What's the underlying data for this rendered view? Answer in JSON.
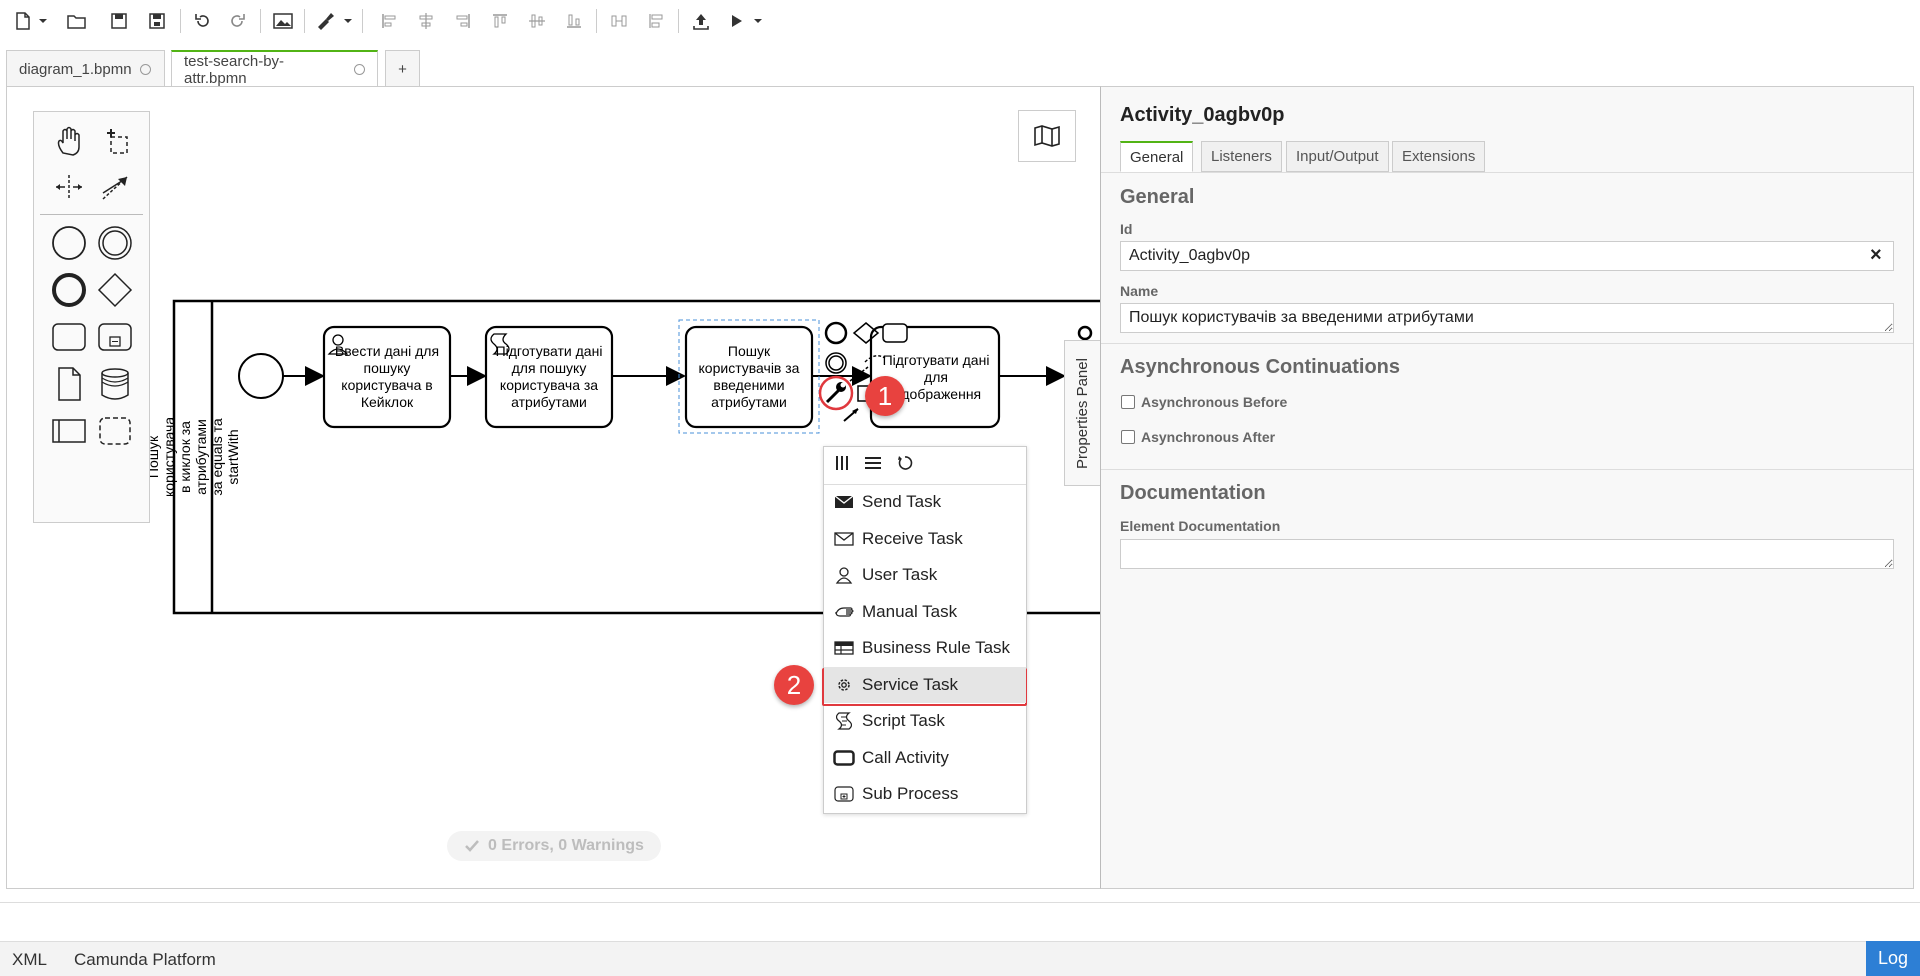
{
  "toolbar": {
    "buttons": [
      "new-file-icon",
      "open-folder-icon",
      "save-icon",
      "save-as-icon",
      "undo-icon",
      "redo-icon",
      "export-image-icon",
      "color-brush-icon",
      "align-left-icon",
      "align-center-icon",
      "align-right-icon",
      "align-top-icon",
      "align-middle-icon",
      "align-bottom-icon",
      "distribute-horizontal-icon",
      "distribute-vertical-icon",
      "deploy-icon",
      "run-icon"
    ]
  },
  "tabs": [
    {
      "label": "diagram_1.bpmn",
      "active": false
    },
    {
      "label": "test-search-by-attr.bpmn",
      "active": true
    }
  ],
  "add_tab_label": "+",
  "diagram": {
    "pool_label": "Пошук користувача в киклок за атрибутами за equals та startWith",
    "tasks": [
      {
        "label": "Ввести дані для пошуку користувача в Кейклок",
        "type": "user"
      },
      {
        "label": "Підготувати дані для пошуку користувача за атрибутами",
        "type": "script"
      },
      {
        "label": "Пошук користувачів за введеними атрибутами",
        "type": "task",
        "selected": true
      },
      {
        "label": "Підготувати дані для відображення",
        "type": "user"
      }
    ]
  },
  "popup_menu": {
    "items": [
      {
        "label": "Send Task",
        "icon": "envelope-filled-icon"
      },
      {
        "label": "Receive Task",
        "icon": "envelope-outline-icon"
      },
      {
        "label": "User Task",
        "icon": "user-icon"
      },
      {
        "label": "Manual Task",
        "icon": "hand-icon"
      },
      {
        "label": "Business Rule Task",
        "icon": "table-icon"
      },
      {
        "label": "Service Task",
        "icon": "gear-icon",
        "highlighted": true
      },
      {
        "label": "Script Task",
        "icon": "script-icon"
      },
      {
        "label": "Call Activity",
        "icon": "call-activity-icon"
      },
      {
        "label": "Sub Process",
        "icon": "subprocess-icon"
      }
    ]
  },
  "badges": [
    "1",
    "2"
  ],
  "status": "0 Errors, 0 Warnings",
  "properties": {
    "toggle_label": "Properties Panel",
    "title": "Activity_0agbv0p",
    "tabs": [
      "General",
      "Listeners",
      "Input/Output",
      "Extensions"
    ],
    "general_heading": "General",
    "id_label": "Id",
    "id_value": "Activity_0agbv0p",
    "name_label": "Name",
    "name_value": "Пошук користувачів за введеними атрибутами",
    "async_heading": "Asynchronous Continuations",
    "async_before": "Asynchronous Before",
    "async_after": "Asynchronous After",
    "doc_heading": "Documentation",
    "doc_label": "Element Documentation",
    "clear_symbol": "×"
  },
  "footer": {
    "xml": "XML",
    "platform": "Camunda Platform",
    "log": "Log"
  }
}
